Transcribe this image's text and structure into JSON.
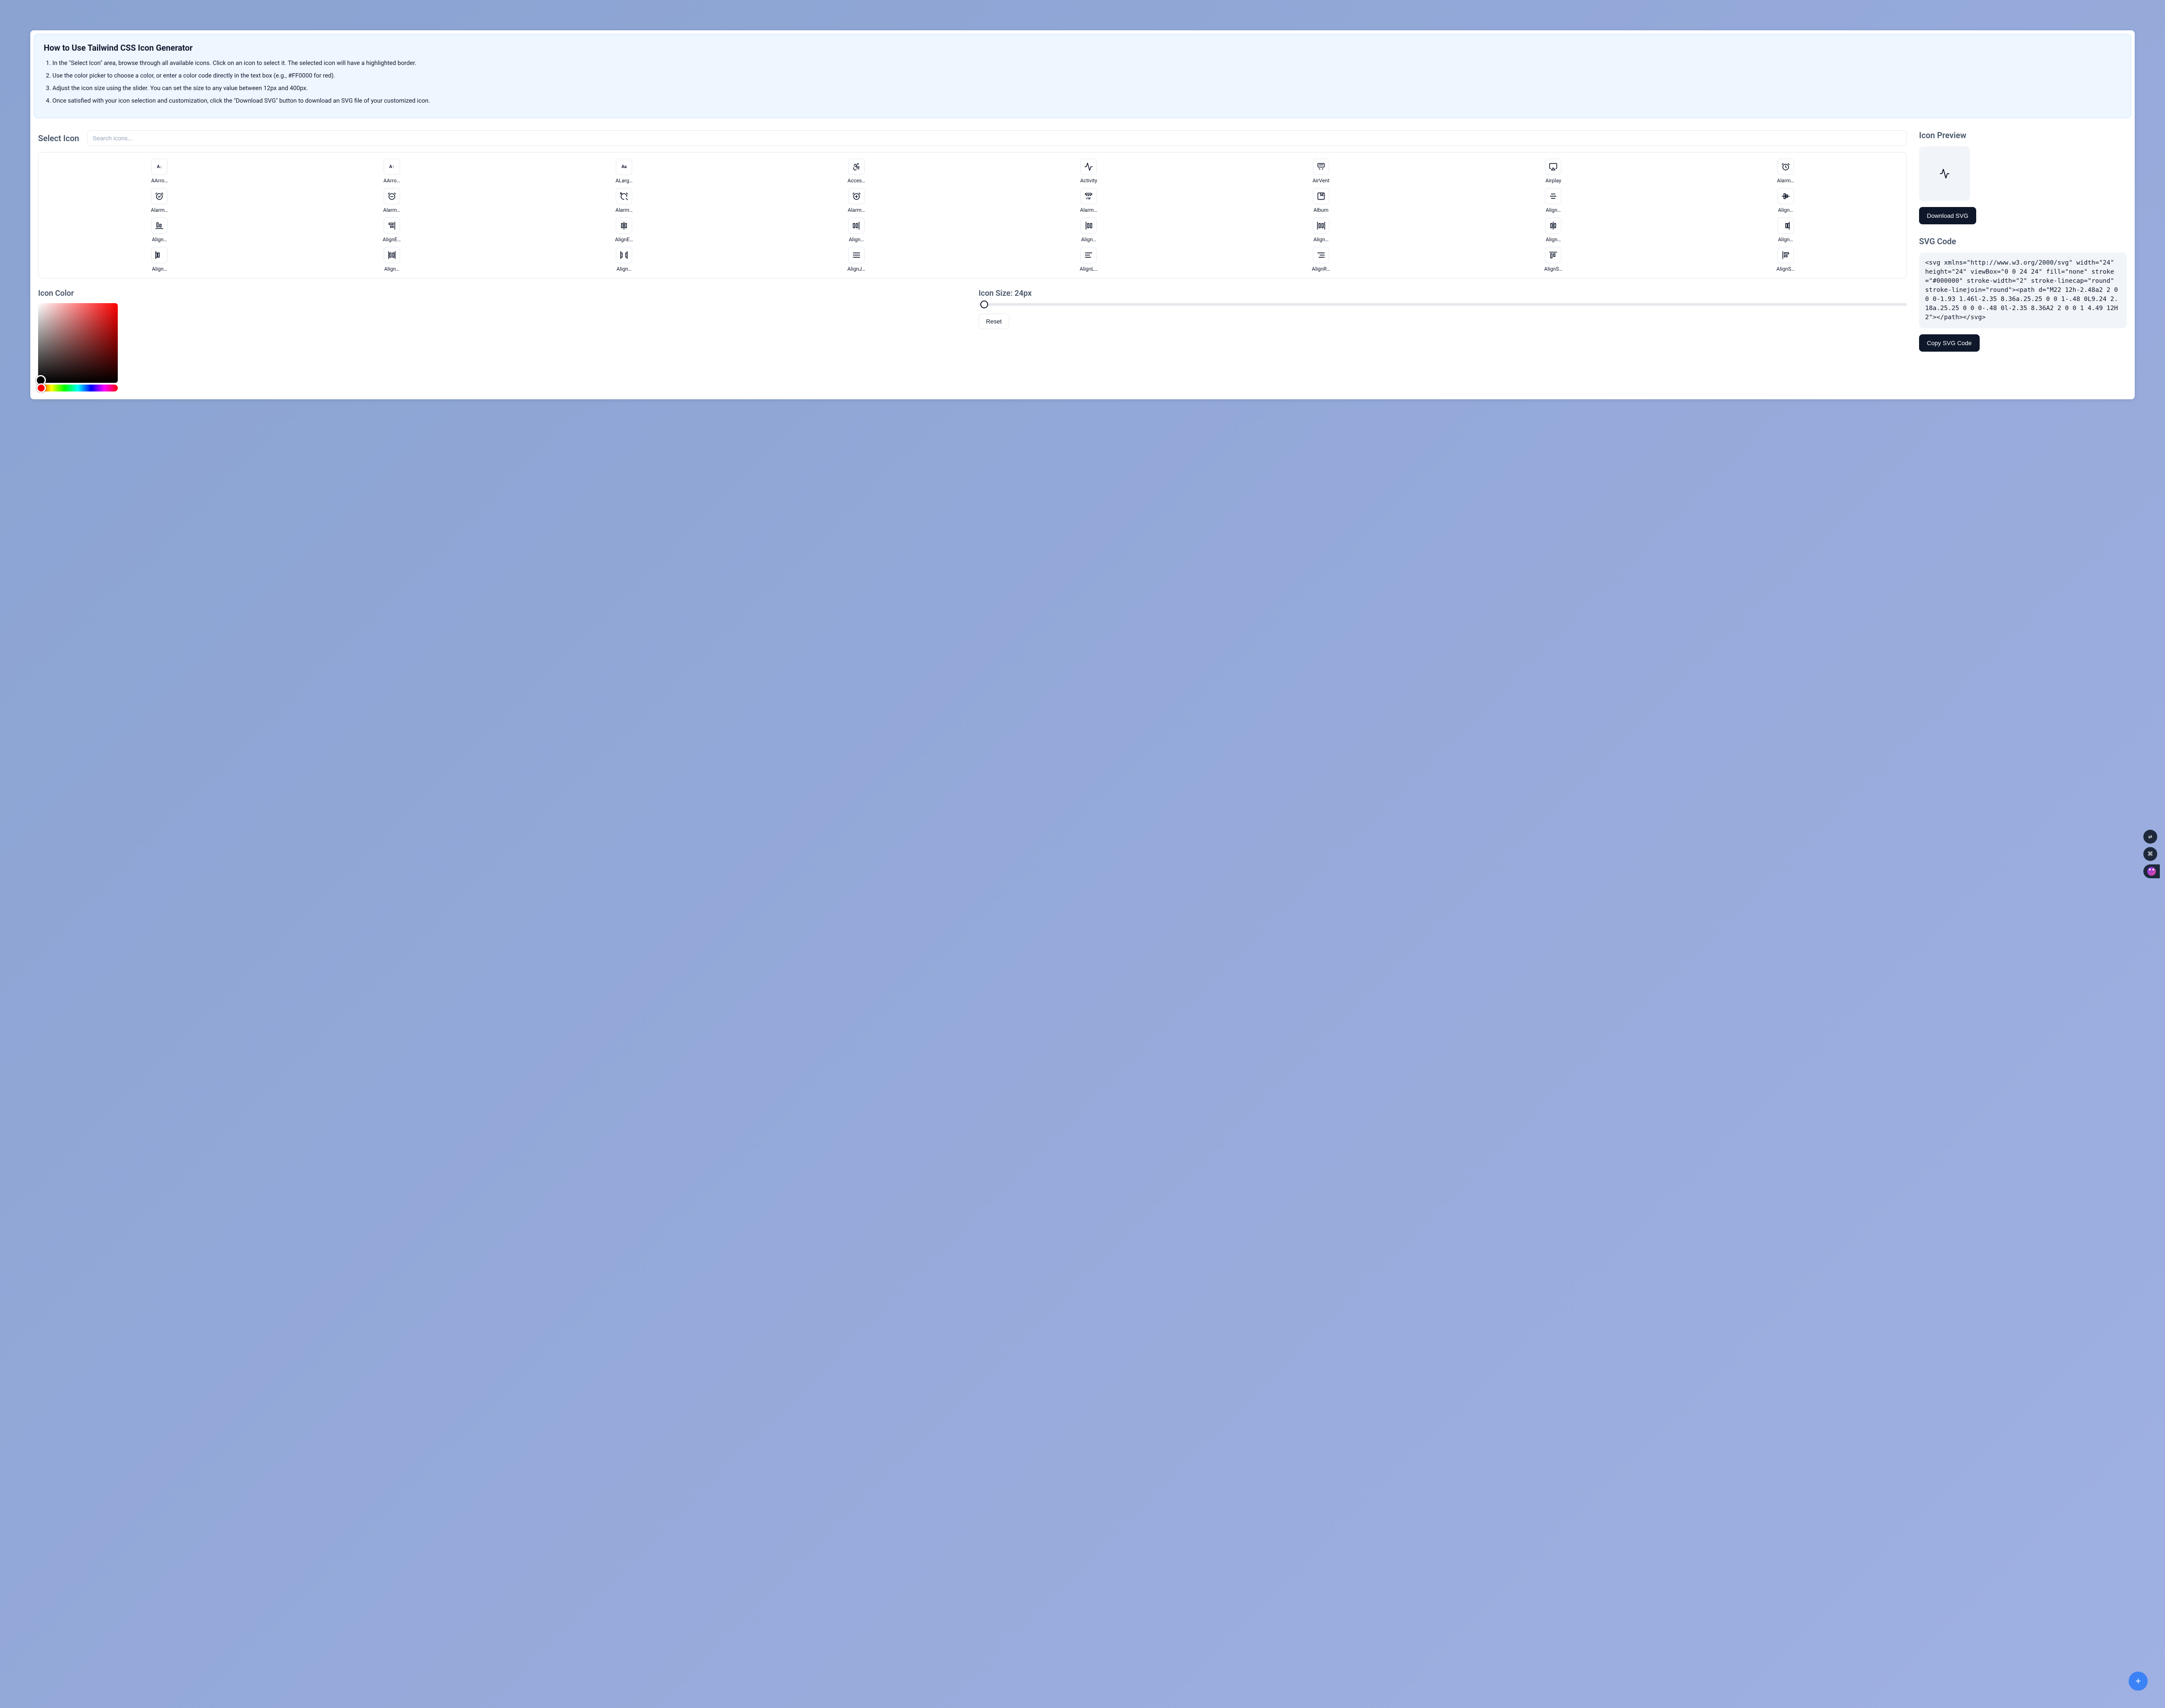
{
  "info": {
    "title": "How to Use Tailwind CSS Icon Generator",
    "steps": [
      "In the \"Select Icon\" area, browse through all available icons. Click on an icon to select it. The selected icon will have a highlighted border.",
      "Use the color picker to choose a color, or enter a color code directly in the text box (e.g., #FF0000 for red).",
      "Adjust the icon size using the slider. You can set the size to any value between 12px and 400px.",
      "Once satisfied with your icon selection and customization, click the \"Download SVG\" button to download an SVG file of your customized icon."
    ]
  },
  "select": {
    "title": "Select Icon",
    "search_placeholder": "Search icons...",
    "icons": [
      {
        "label": "AArro…",
        "glyph": "A↓"
      },
      {
        "label": "AArro…",
        "glyph": "A↑"
      },
      {
        "label": "ALarg…",
        "glyph": "Aa"
      },
      {
        "label": "Acces…",
        "svg": "accessibility"
      },
      {
        "label": "Activity",
        "svg": "activity"
      },
      {
        "label": "AirVent",
        "svg": "airvent"
      },
      {
        "label": "Airplay",
        "svg": "airplay"
      },
      {
        "label": "Alarm…",
        "svg": "alarm"
      },
      {
        "label": "Alarm…",
        "svg": "alarm-check"
      },
      {
        "label": "Alarm…",
        "svg": "alarm-minus"
      },
      {
        "label": "Alarm…",
        "svg": "alarm-off"
      },
      {
        "label": "Alarm…",
        "svg": "alarm-plus"
      },
      {
        "label": "Alarm…",
        "svg": "alarm-smoke"
      },
      {
        "label": "Album",
        "svg": "album"
      },
      {
        "label": "Align…",
        "svg": "align-center-h"
      },
      {
        "label": "Align…",
        "svg": "align-center-v"
      },
      {
        "label": "Align…",
        "svg": "align-end-h"
      },
      {
        "label": "AlignE…",
        "svg": "align-end-v"
      },
      {
        "label": "AlignE…",
        "svg": "align-h-dc"
      },
      {
        "label": "Align…",
        "svg": "align-h-de"
      },
      {
        "label": "Align…",
        "svg": "align-h-ds"
      },
      {
        "label": "Align…",
        "svg": "align-h-ja"
      },
      {
        "label": "Align…",
        "svg": "align-h-jc"
      },
      {
        "label": "Align…",
        "svg": "align-h-je"
      },
      {
        "label": "Align…",
        "svg": "align-h-js"
      },
      {
        "label": "Align…",
        "svg": "align-h-sa"
      },
      {
        "label": "Align…",
        "svg": "align-h-sb"
      },
      {
        "label": "AlignJ…",
        "svg": "align-justify"
      },
      {
        "label": "AlignL…",
        "svg": "align-left"
      },
      {
        "label": "AlignR…",
        "svg": "align-right"
      },
      {
        "label": "AlignS…",
        "svg": "align-start-h"
      },
      {
        "label": "AlignS…",
        "svg": "align-start-v"
      }
    ]
  },
  "color": {
    "title": "Icon Color"
  },
  "size": {
    "title": "Icon Size: 24px",
    "reset_label": "Reset"
  },
  "preview": {
    "title": "Icon Preview",
    "download_label": "Download SVG"
  },
  "code": {
    "title": "SVG Code",
    "value": "<svg xmlns=\"http://www.w3.org/2000/svg\" width=\"24\" height=\"24\" viewBox=\"0 0 24 24\" fill=\"none\" stroke=\"#000000\" stroke-width=\"2\" stroke-linecap=\"round\" stroke-linejoin=\"round\"><path d=\"M22 12h-2.48a2 2 0 0 0-1.93 1.46l-2.35 8.36a.25.25 0 0 1-.48 0L9.24 2.18a.25.25 0 0 0-.48 0l-2.35 8.36A2 2 0 0 1 4.49 12H2\"></path></svg>",
    "copy_label": "Copy SVG Code"
  },
  "fab": {
    "label": "+"
  },
  "side": {
    "translate": "⇄",
    "cmd": "⌘"
  }
}
